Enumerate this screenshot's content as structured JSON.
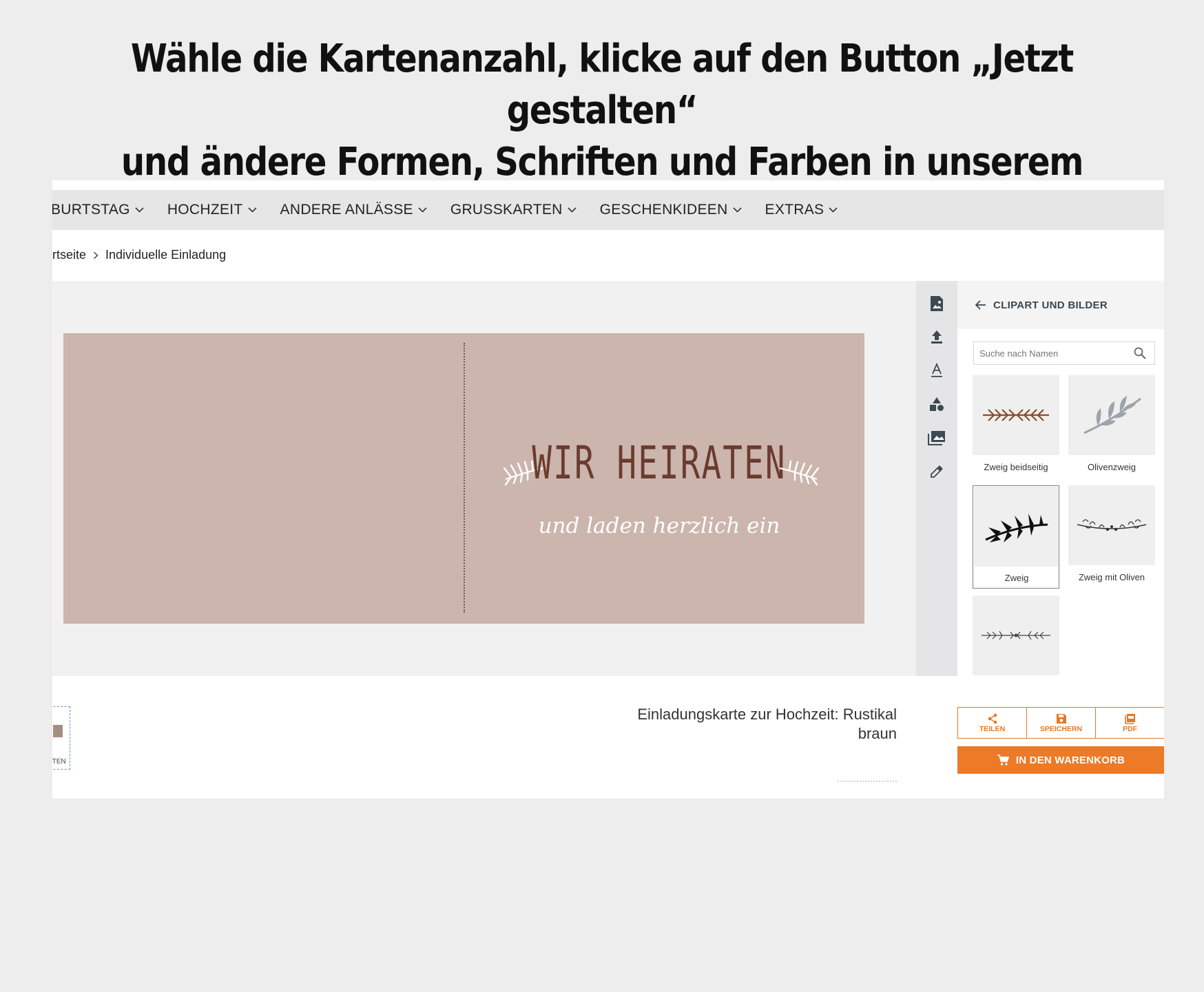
{
  "headline": {
    "line1": "Wähle die Kartenanzahl, klicke auf den Button „Jetzt gestalten“",
    "line2": "und ändere Formen, Schriften und Farben in unserem Editor!"
  },
  "nav": {
    "items": [
      {
        "label": "BURTSTAG"
      },
      {
        "label": "HOCHZEIT"
      },
      {
        "label": "ANDERE ANLÄSSE"
      },
      {
        "label": "GRUSSKARTEN"
      },
      {
        "label": "GESCHENKIDEEN"
      },
      {
        "label": "EXTRAS"
      }
    ]
  },
  "breadcrumb": {
    "home": "rtseite",
    "current": "Individuelle Einladung"
  },
  "card": {
    "title": "WIR HEIRATEN",
    "subtitle": "und laden herzlich ein",
    "background": "#cbb5ad",
    "title_color": "#6a3b2e"
  },
  "toolbar": {
    "tools": [
      "image-icon",
      "upload-icon",
      "text-icon",
      "shapes-icon",
      "gallery-icon",
      "eyedropper-icon"
    ]
  },
  "panel": {
    "title": "CLIPART UND BILDER",
    "search_placeholder": "Suche nach Namen",
    "items": [
      {
        "label": "Zweig beidseitig"
      },
      {
        "label": "Olivenzweig"
      },
      {
        "label": "Zweig"
      },
      {
        "label": "Zweig mit Oliven"
      },
      {
        "label": ""
      }
    ]
  },
  "product": {
    "title_line1": "Einladungskarte zur Hochzeit: Rustikal",
    "title_line2": "braun",
    "thumb_text": "ITEN"
  },
  "actions": {
    "share": "TEILEN",
    "save": "SPEICHERN",
    "pdf": "PDF",
    "cart": "IN DEN WARENKORB"
  },
  "colors": {
    "accent": "#ec7a27",
    "background": "#ecedec"
  }
}
